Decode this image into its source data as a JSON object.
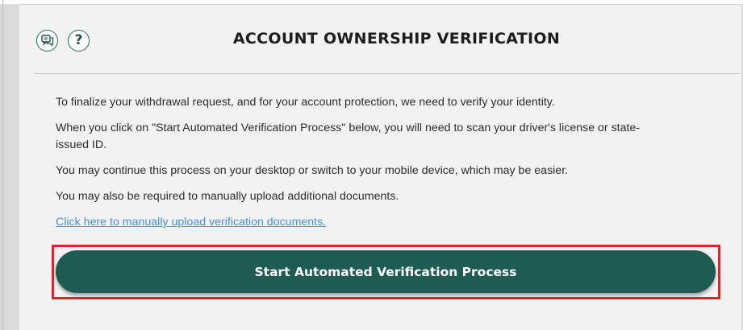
{
  "top_strip": {
    "cut_text": "▔ ▔ ▔ ▔▔▔▔        ▔▔▔▔ ▔"
  },
  "modal": {
    "title": "ACCOUNT OWNERSHIP VERIFICATION",
    "icons": {
      "chat": "chat-icon",
      "help": "help-icon",
      "help_glyph": "?"
    },
    "paragraphs": [
      "To finalize your withdrawal request, and for your account protection, we need to verify your identity.",
      "When you click on \"Start Automated Verification Process\" below, you will need to scan your driver's license or state-issued ID.",
      "You may continue this process on your desktop or switch to your mobile device, which may be easier.",
      "You may also be required to manually upload additional documents."
    ],
    "manual_upload_link": "Click here to manually upload verification documents.",
    "start_button_label": "Start Automated Verification Process"
  },
  "colors": {
    "accent": "#1e5b52",
    "link": "#4a8fd6",
    "highlight": "#e4212b",
    "background": "#f2f2f2"
  }
}
